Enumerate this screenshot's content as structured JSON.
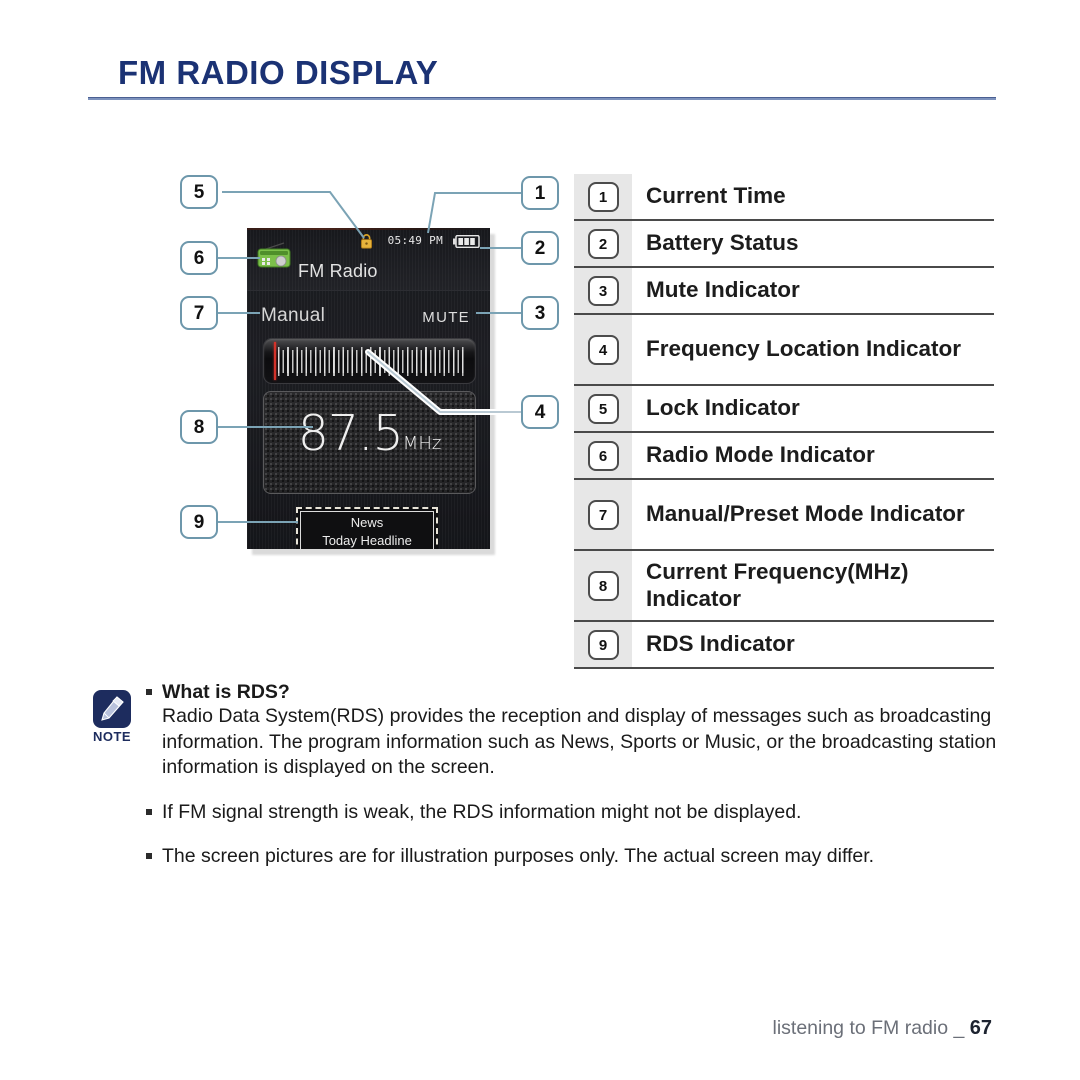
{
  "page": {
    "title": "FM RADIO DISPLAY",
    "footer_text": "listening to FM radio _",
    "page_number": "67",
    "title_color": "#1b3274",
    "rule_color": "#7d92bd"
  },
  "device": {
    "status_bar": {
      "time": "05:49 PM",
      "lock_icon": "lock-icon",
      "battery_icon": "battery-icon",
      "radio_icon": "radio-mode-icon"
    },
    "app_title": "FM Radio",
    "tuning_mode": "Manual",
    "mute_label": "MUTE",
    "frequency_value": "87.5",
    "frequency_unit": "MHz",
    "rds": {
      "line1": "News",
      "line2": "Today Headline"
    }
  },
  "callouts": {
    "left": [
      "5",
      "6",
      "7",
      "8",
      "9"
    ],
    "right": [
      "1",
      "2",
      "3",
      "4"
    ]
  },
  "legend": {
    "rows": [
      {
        "num": "1",
        "label": "Current Time"
      },
      {
        "num": "2",
        "label": "Battery Status"
      },
      {
        "num": "3",
        "label": "Mute Indicator"
      },
      {
        "num": "4",
        "label": "Frequency Location Indicator"
      },
      {
        "num": "5",
        "label": "Lock Indicator"
      },
      {
        "num": "6",
        "label": "Radio Mode Indicator"
      },
      {
        "num": "7",
        "label": "Manual/Preset Mode Indicator"
      },
      {
        "num": "8",
        "label": "Current Frequency(MHz) Indicator"
      },
      {
        "num": "9",
        "label": "RDS Indicator"
      }
    ]
  },
  "note": {
    "badge_label": "NOTE",
    "heading": "What is RDS?",
    "paragraph": "Radio Data System(RDS) provides the reception and display of messages such as broadcasting information. The program information such as News, Sports or Music, or the broadcasting station information is displayed on the screen.",
    "bullets": [
      "If FM signal strength is weak, the RDS information might not be displayed.",
      "The screen pictures are for illustration purposes only. The actual screen may differ."
    ]
  }
}
